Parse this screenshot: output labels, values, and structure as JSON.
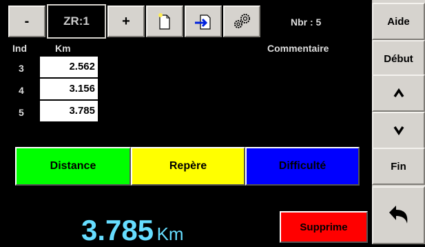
{
  "toolbar": {
    "minus_label": "-",
    "zoom_label": "ZR:1",
    "plus_label": "+",
    "count_text": "Nbr : 5"
  },
  "side": {
    "help_label": "Aide",
    "start_label": "Début",
    "up_label": "^",
    "down_label": "v",
    "end_label": "Fin"
  },
  "table": {
    "headers": {
      "ind": "Ind",
      "km": "Km",
      "comment": "Commentaire"
    },
    "rows": [
      {
        "ind": "3",
        "km": "2.562"
      },
      {
        "ind": "4",
        "km": "3.156"
      },
      {
        "ind": "5",
        "km": "3.785"
      }
    ]
  },
  "modes": {
    "distance_label": "Distance",
    "distance_color": "#00ff00",
    "repere_label": "Repère",
    "repere_color": "#ffff00",
    "difficulte_label": "Difficulté",
    "difficulte_color": "#0000ff"
  },
  "readout": {
    "value": "3.785",
    "unit": "Km",
    "color": "#66ddff"
  },
  "delete_label": "Supprime",
  "delete_color": "#ff0000",
  "icons": [
    "new-file-icon",
    "import-icon",
    "settings-gears-icon",
    "back-arrow-icon"
  ]
}
